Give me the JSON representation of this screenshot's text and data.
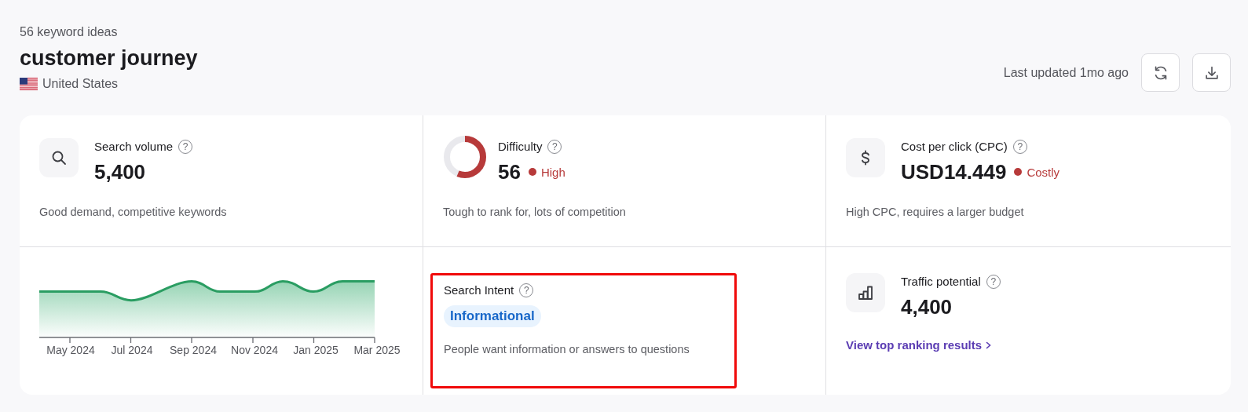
{
  "header": {
    "count": "56 keyword ideas",
    "keyword": "customer journey",
    "country": "United States",
    "last_updated": "Last updated 1mo ago",
    "actions": [
      {
        "kind": "refresh"
      },
      {
        "kind": "download"
      }
    ]
  },
  "metrics": [
    {
      "kind": "volume",
      "title": "Search volume",
      "help": "?",
      "value": "5,400",
      "description": "Good demand, competitive keywords"
    },
    {
      "kind": "difficulty",
      "title": "Difficulty",
      "help": "?",
      "value": "56",
      "rating": "High",
      "color": "#b73a3a",
      "description": "Tough to rank for, lots of competition"
    },
    {
      "kind": "cpc",
      "title": "Cost per click (CPC)",
      "help": "?",
      "value": "USD14.449",
      "rating": "Costly",
      "color": "#b73a3a",
      "description": "High CPC, requires a larger budget"
    },
    {
      "kind": "trend",
      "ticks": [
        "May 2024",
        "Jul 2024",
        "Sep 2024",
        "Nov 2024",
        "Jan 2025",
        "Mar 2025"
      ]
    },
    {
      "kind": "intent",
      "title": "Search Intent",
      "help": "?",
      "tag": "Informational",
      "description": "People want information or answers to questions",
      "highlighted": true
    },
    {
      "kind": "traffic",
      "title": "Traffic potential",
      "help": "?",
      "value": "4,400",
      "link": "View top ranking results"
    }
  ]
}
